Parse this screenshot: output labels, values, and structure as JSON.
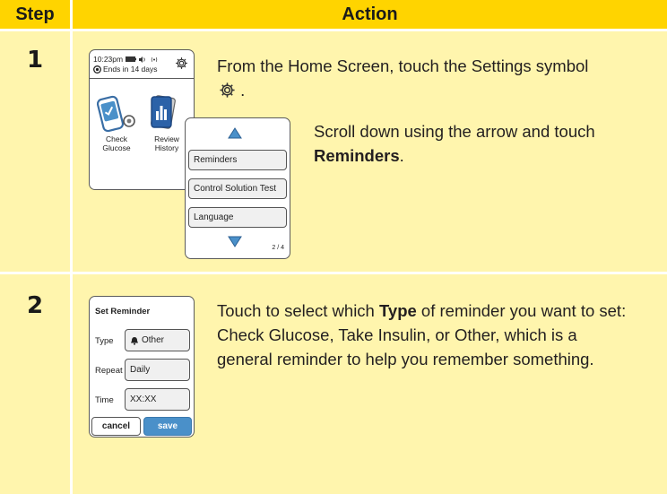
{
  "header": {
    "step": "Step",
    "action": "Action"
  },
  "colors": {
    "header": "#ffd400",
    "cell": "#fff5ad",
    "save_button": "#4a90c9"
  },
  "rows": [
    {
      "step": "1",
      "home_screen": {
        "time": "10:23pm",
        "sensor_status": "Ends in 14 days",
        "check_label_1": "Check",
        "check_label_2": "Glucose",
        "review_label_1": "Review",
        "review_label_2": "History"
      },
      "settings_menu": {
        "items": [
          "Reminders",
          "Control Solution Test",
          "Language"
        ],
        "page": "2 / 4"
      },
      "instruction_1": "From the Home Screen, touch the Settings symbol",
      "instruction_1_end": ".",
      "instruction_2_pre": "Scroll down using the arrow and touch ",
      "instruction_2_bold": "Reminders",
      "instruction_2_post": "."
    },
    {
      "step": "2",
      "set_reminder": {
        "title": "Set Reminder",
        "type_label": "Type",
        "type_value": "Other",
        "repeat_label": "Repeat",
        "repeat_value": "Daily",
        "time_label": "Time",
        "time_value": "XX:XX",
        "cancel": "cancel",
        "save": "save"
      },
      "instruction_pre": "Touch to select which ",
      "instruction_bold": "Type",
      "instruction_post": " of reminder you want to set: Check Glucose, Take Insulin, or Other, which is a general reminder to help you remember something."
    }
  ]
}
